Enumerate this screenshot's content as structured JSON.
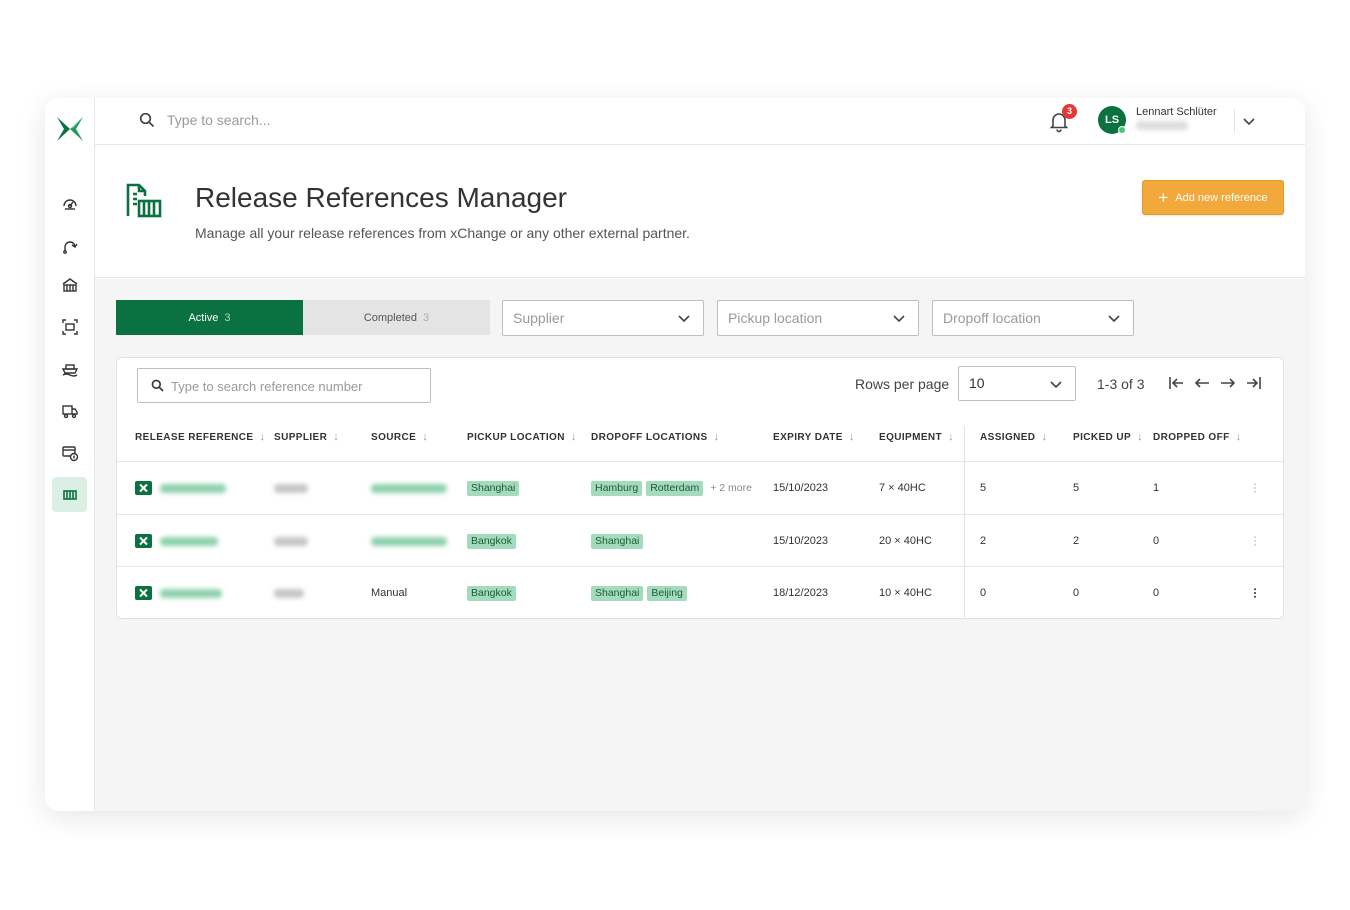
{
  "topbar": {
    "search_placeholder": "Type to search...",
    "notification_count": "3",
    "user": {
      "initials": "LS",
      "name": "Lennart Schlüter"
    }
  },
  "sidebar": {
    "items": [
      {
        "icon": "dashboard-icon"
      },
      {
        "icon": "routes-icon"
      },
      {
        "icon": "warehouse-icon"
      },
      {
        "icon": "container-scan-icon"
      },
      {
        "icon": "ship-icon"
      },
      {
        "icon": "truck-icon"
      },
      {
        "icon": "billing-icon"
      },
      {
        "icon": "release-references-icon",
        "active": true
      }
    ]
  },
  "header": {
    "title": "Release References Manager",
    "subtitle": "Manage all your release references from xChange or any other external partner.",
    "add_button": "Add new reference"
  },
  "tabs": [
    {
      "label": "Active",
      "count": "3",
      "active": true
    },
    {
      "label": "Completed",
      "count": "3",
      "active": false
    }
  ],
  "filters": {
    "supplier": "Supplier",
    "pickup": "Pickup location",
    "dropoff": "Dropoff location"
  },
  "table_controls": {
    "search_placeholder": "Type to search reference number",
    "rows_label": "Rows per page",
    "rows_value": "10",
    "page_info": "1-3 of 3"
  },
  "columns": {
    "release_reference": "RELEASE REFERENCE",
    "supplier": "SUPPLIER",
    "source": "SOURCE",
    "pickup": "PICKUP LOCATION",
    "dropoff": "DROPOFF LOCATIONS",
    "expiry": "EXPIRY DATE",
    "equipment": "EQUIPMENT",
    "assigned": "ASSIGNED",
    "picked_up": "PICKED UP",
    "dropped_off": "DROPPED OFF"
  },
  "rows": [
    {
      "source": "",
      "pickup": "Shanghai",
      "dropoff": [
        "Hamburg",
        "Rotterdam"
      ],
      "more": "+ 2 more",
      "expiry": "15/10/2023",
      "equipment": "7 × 40HC",
      "assigned": "5",
      "picked_up": "5",
      "dropped_off": "1"
    },
    {
      "source": "",
      "pickup": "Bangkok",
      "dropoff": [
        "Shanghai",
        ""
      ],
      "more": "",
      "expiry": "15/10/2023",
      "equipment": "20 × 40HC",
      "assigned": "2",
      "picked_up": "2",
      "dropped_off": "0"
    },
    {
      "source": "Manual",
      "pickup": "Bangkok",
      "dropoff": [
        "Shanghai",
        "Beijing"
      ],
      "more": "",
      "expiry": "18/12/2023",
      "equipment": "10 × 40HC",
      "assigned": "0",
      "picked_up": "0",
      "dropped_off": "0"
    }
  ],
  "colors": {
    "brand_green": "#0a7140",
    "accent_orange": "#f2a93b",
    "tag_green": "#a5dbbd",
    "badge_red": "#e53935"
  }
}
